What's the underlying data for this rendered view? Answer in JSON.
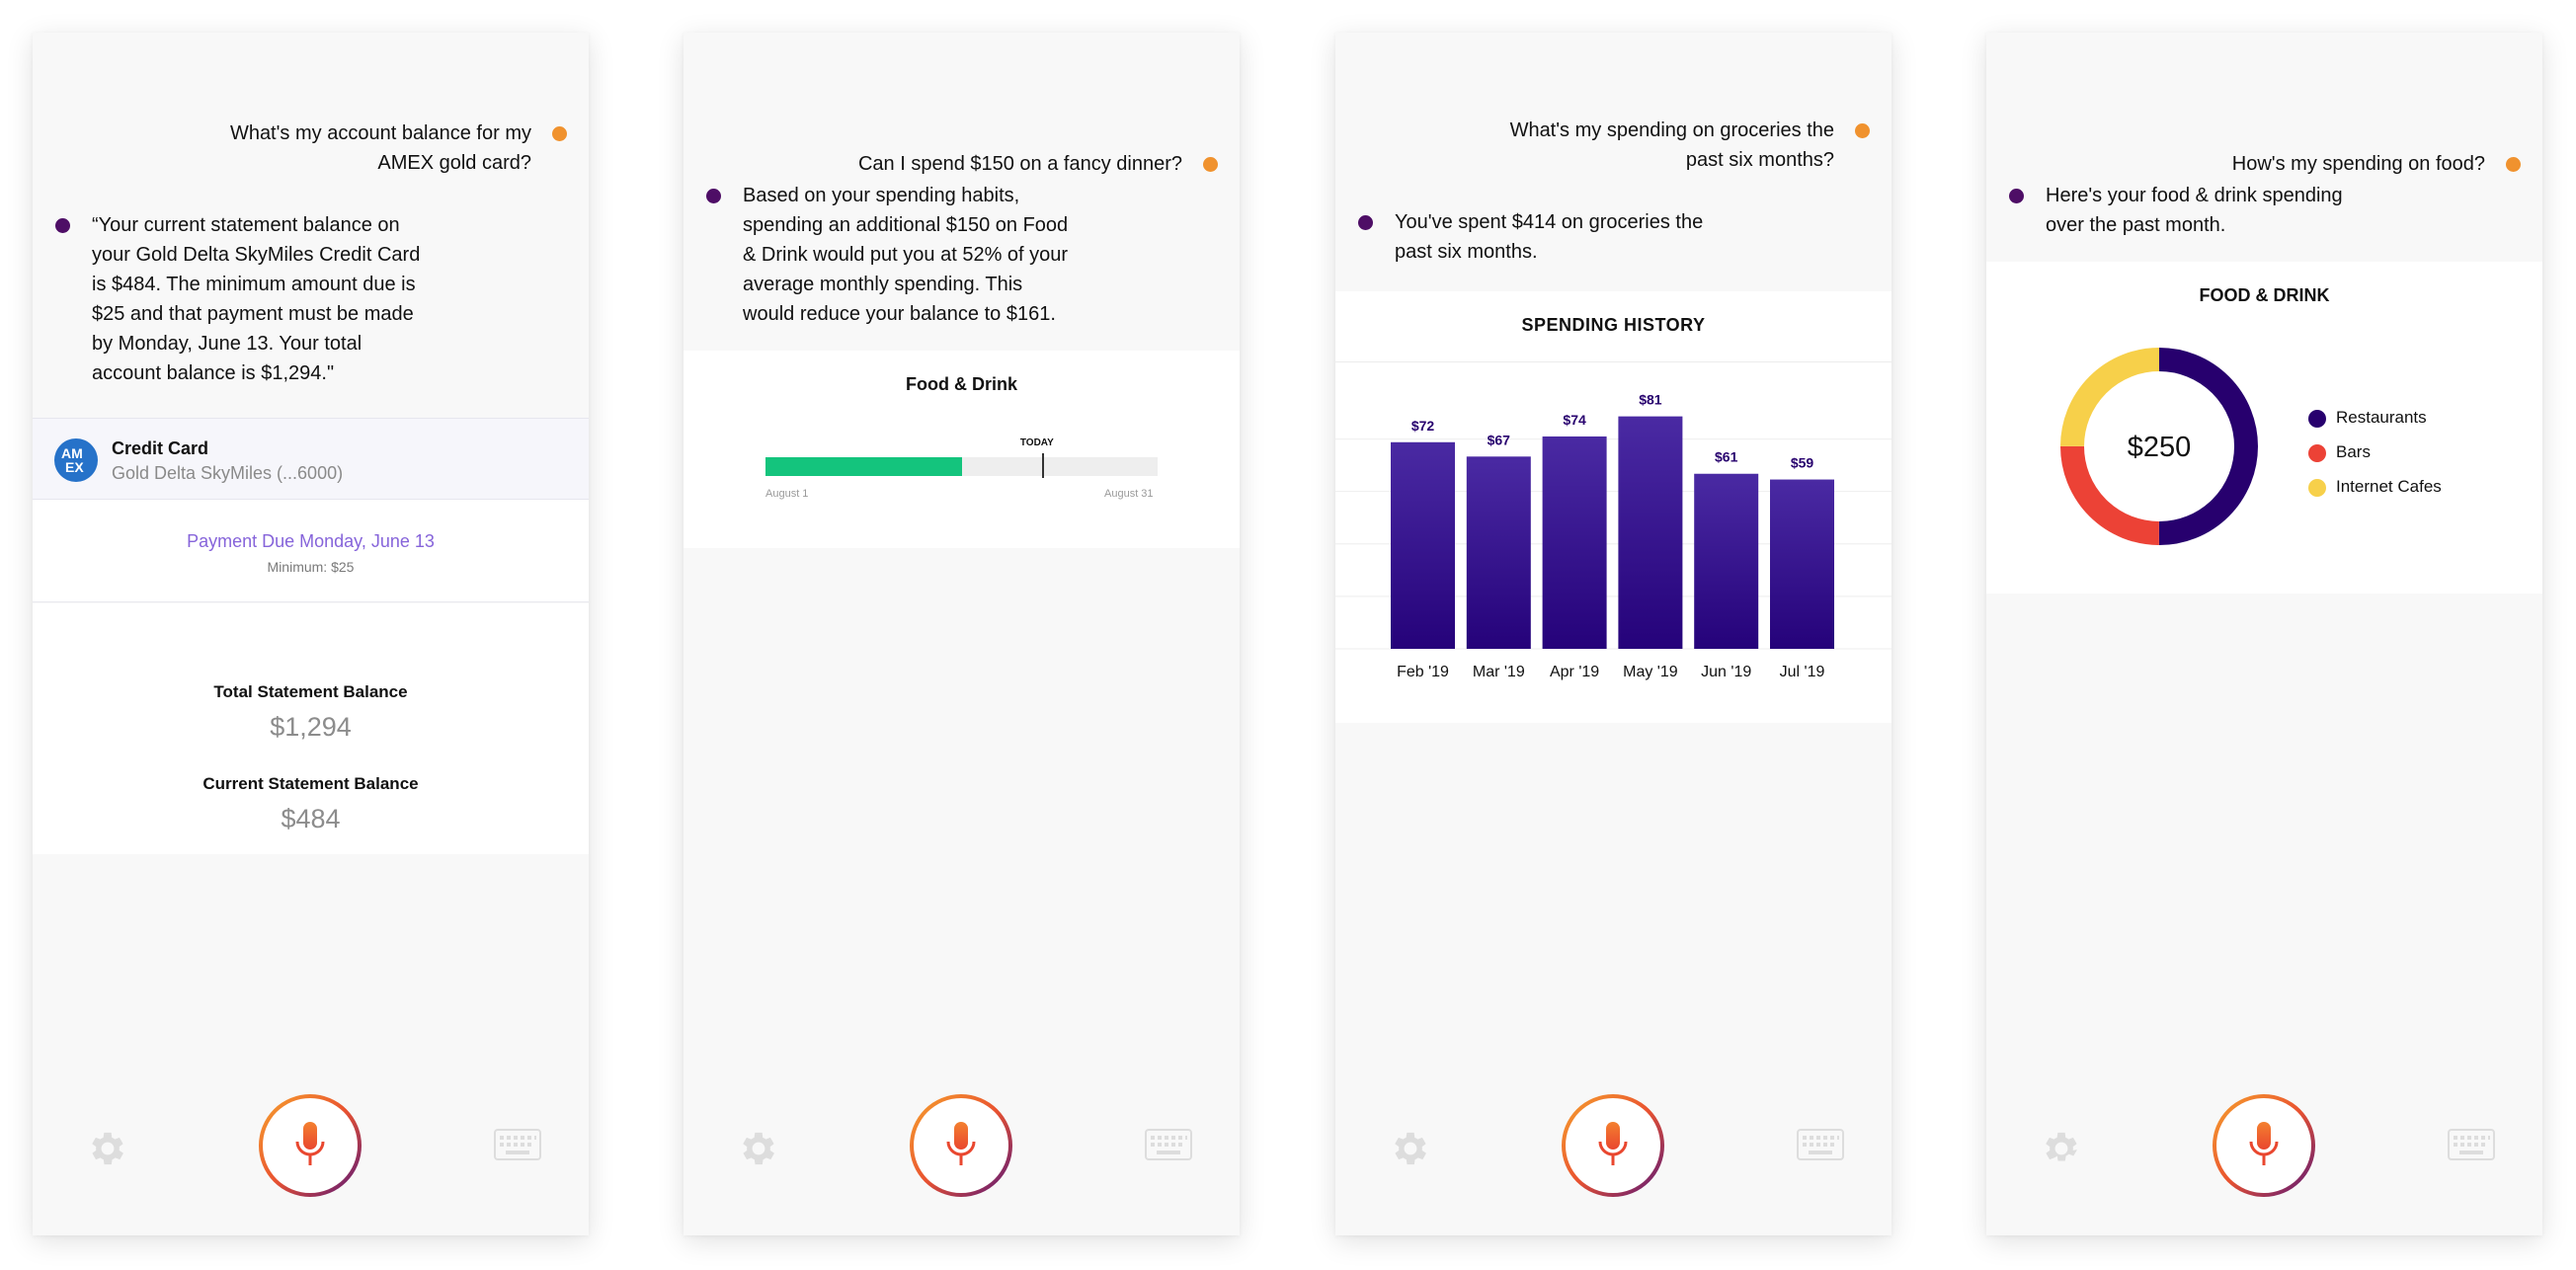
{
  "panel1": {
    "user_message": "What's my account balance for my AMEX gold card?",
    "bot_message": "“Your current statement balance on your Gold Delta SkyMiles Credit Card is $484. The minimum amount due is $25 and that payment must be made by Monday, June 13. Your total account balance is $1,294.\"",
    "card_title": "Credit Card",
    "card_subtitle": "Gold Delta SkyMiles (...6000)",
    "card_logo_text": "AM EX",
    "payment_due": "Payment Due Monday, June 13",
    "minimum": "Minimum: $25",
    "total_label": "Total Statement Balance",
    "total_value": "$1,294",
    "current_label": "Current Statement Balance",
    "current_value": "$484"
  },
  "panel2": {
    "user_message": "Can I spend $150 on a fancy dinner?",
    "bot_message": "Based on your spending habits, spending an additional $150 on Food & Drink would put you at 52% of your average monthly spending. This would reduce your balance to $161.",
    "card_title": "Food & Drink",
    "today_label": "TODAY",
    "progress_fraction": 0.5,
    "today_fraction": 0.705,
    "start_label": "August 1",
    "end_label": "August 31"
  },
  "panel3": {
    "user_message": "What's my spending on groceries the past six months?",
    "bot_message": "You've spent $414 on groceries the past six months.",
    "card_title": "SPENDING HISTORY"
  },
  "panel4": {
    "user_message": "How's my spending on food?",
    "bot_message": "Here's your food & drink spending over the past month.",
    "card_title": "FOOD & DRINK",
    "center_value": "$250",
    "legend": [
      {
        "label": "Restaurants",
        "color": "#27006e"
      },
      {
        "label": "Bars",
        "color": "#ec4236"
      },
      {
        "label": "Internet Cafes",
        "color": "#f7d04a"
      }
    ]
  },
  "footer": {
    "settings_icon": "gear-icon",
    "mic_icon": "microphone-icon",
    "keyboard_icon": "keyboard-icon"
  },
  "chart_data": [
    {
      "type": "bar",
      "title": "SPENDING HISTORY",
      "categories": [
        "Feb '19",
        "Mar '19",
        "Apr '19",
        "May '19",
        "Jun '19",
        "Jul '19"
      ],
      "values": [
        72,
        67,
        74,
        81,
        61,
        59
      ],
      "value_labels": [
        "$72",
        "$67",
        "$74",
        "$81",
        "$61",
        "$59"
      ],
      "color": "#3b1592",
      "grid": true
    },
    {
      "type": "pie",
      "title": "FOOD & DRINK",
      "categories": [
        "Restaurants",
        "Bars",
        "Internet Cafes"
      ],
      "values": [
        0.5,
        0.25,
        0.25
      ],
      "colors": [
        "#27006e",
        "#ec4236",
        "#f7d04a"
      ],
      "donut": true,
      "legend": "right"
    }
  ]
}
